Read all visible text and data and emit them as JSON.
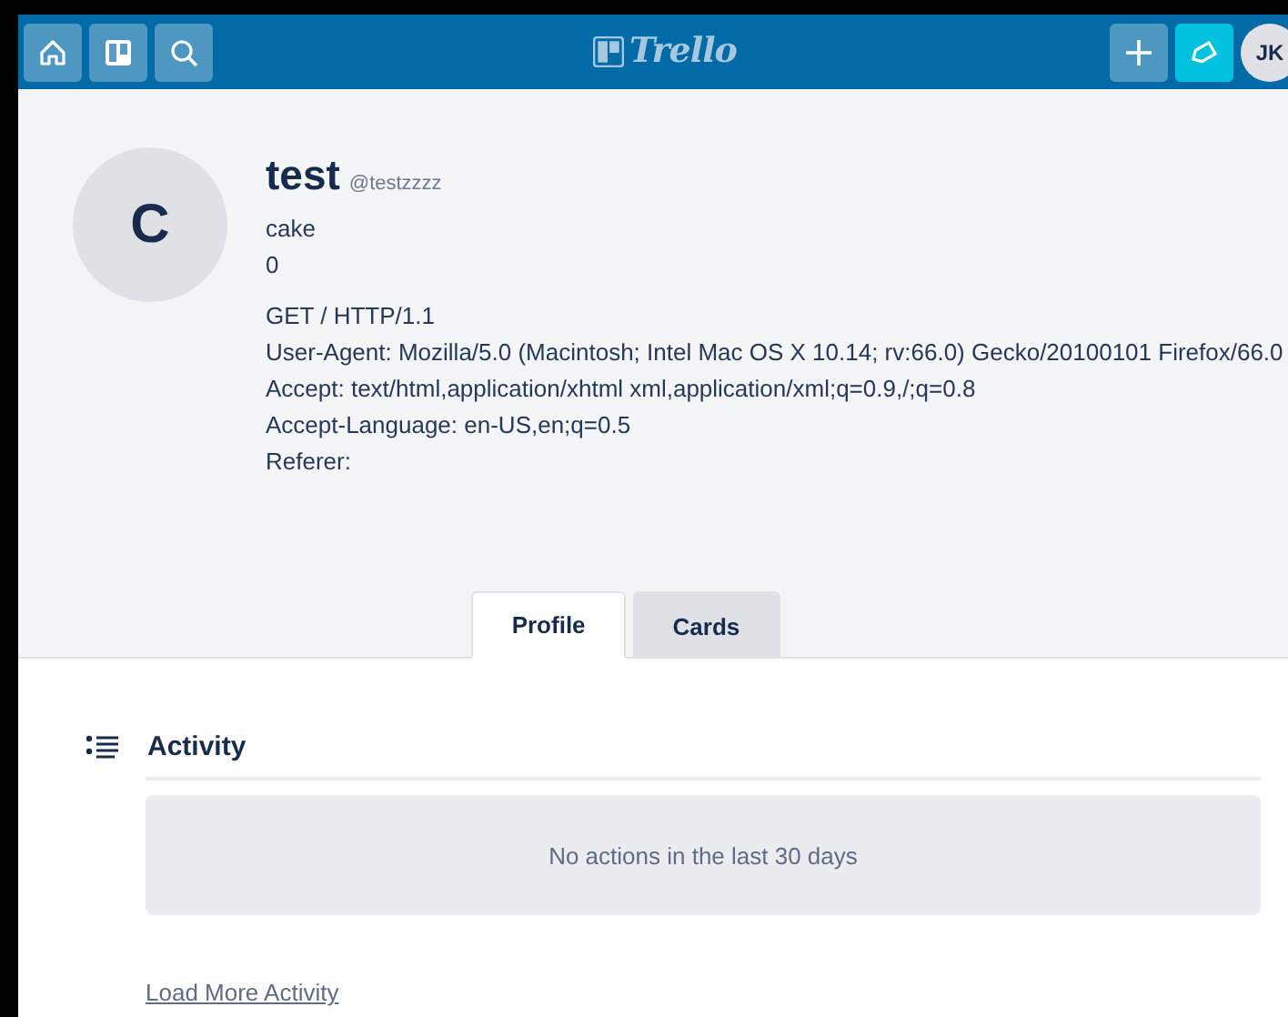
{
  "header": {
    "logo": "Trello",
    "avatar_initials": "JK"
  },
  "profile": {
    "avatar_letter": "C",
    "name": "test",
    "username": "@testzzzz",
    "bio": "cake",
    "count": "0",
    "details": [
      "GET / HTTP/1.1",
      "User-Agent: Mozilla/5.0 (Macintosh; Intel Mac OS X 10.14; rv:66.0) Gecko/20100101 Firefox/66.0",
      "Accept: text/html,application/xhtml xml,application/xml;q=0.9,/;q=0.8",
      "Accept-Language: en-US,en;q=0.5",
      "Referer:"
    ]
  },
  "tabs": [
    {
      "label": "Profile",
      "selected": true
    },
    {
      "label": "Cards",
      "selected": false
    }
  ],
  "activity": {
    "title": "Activity",
    "empty_message": "No actions in the last 30 days",
    "load_more": "Load More Activity"
  }
}
